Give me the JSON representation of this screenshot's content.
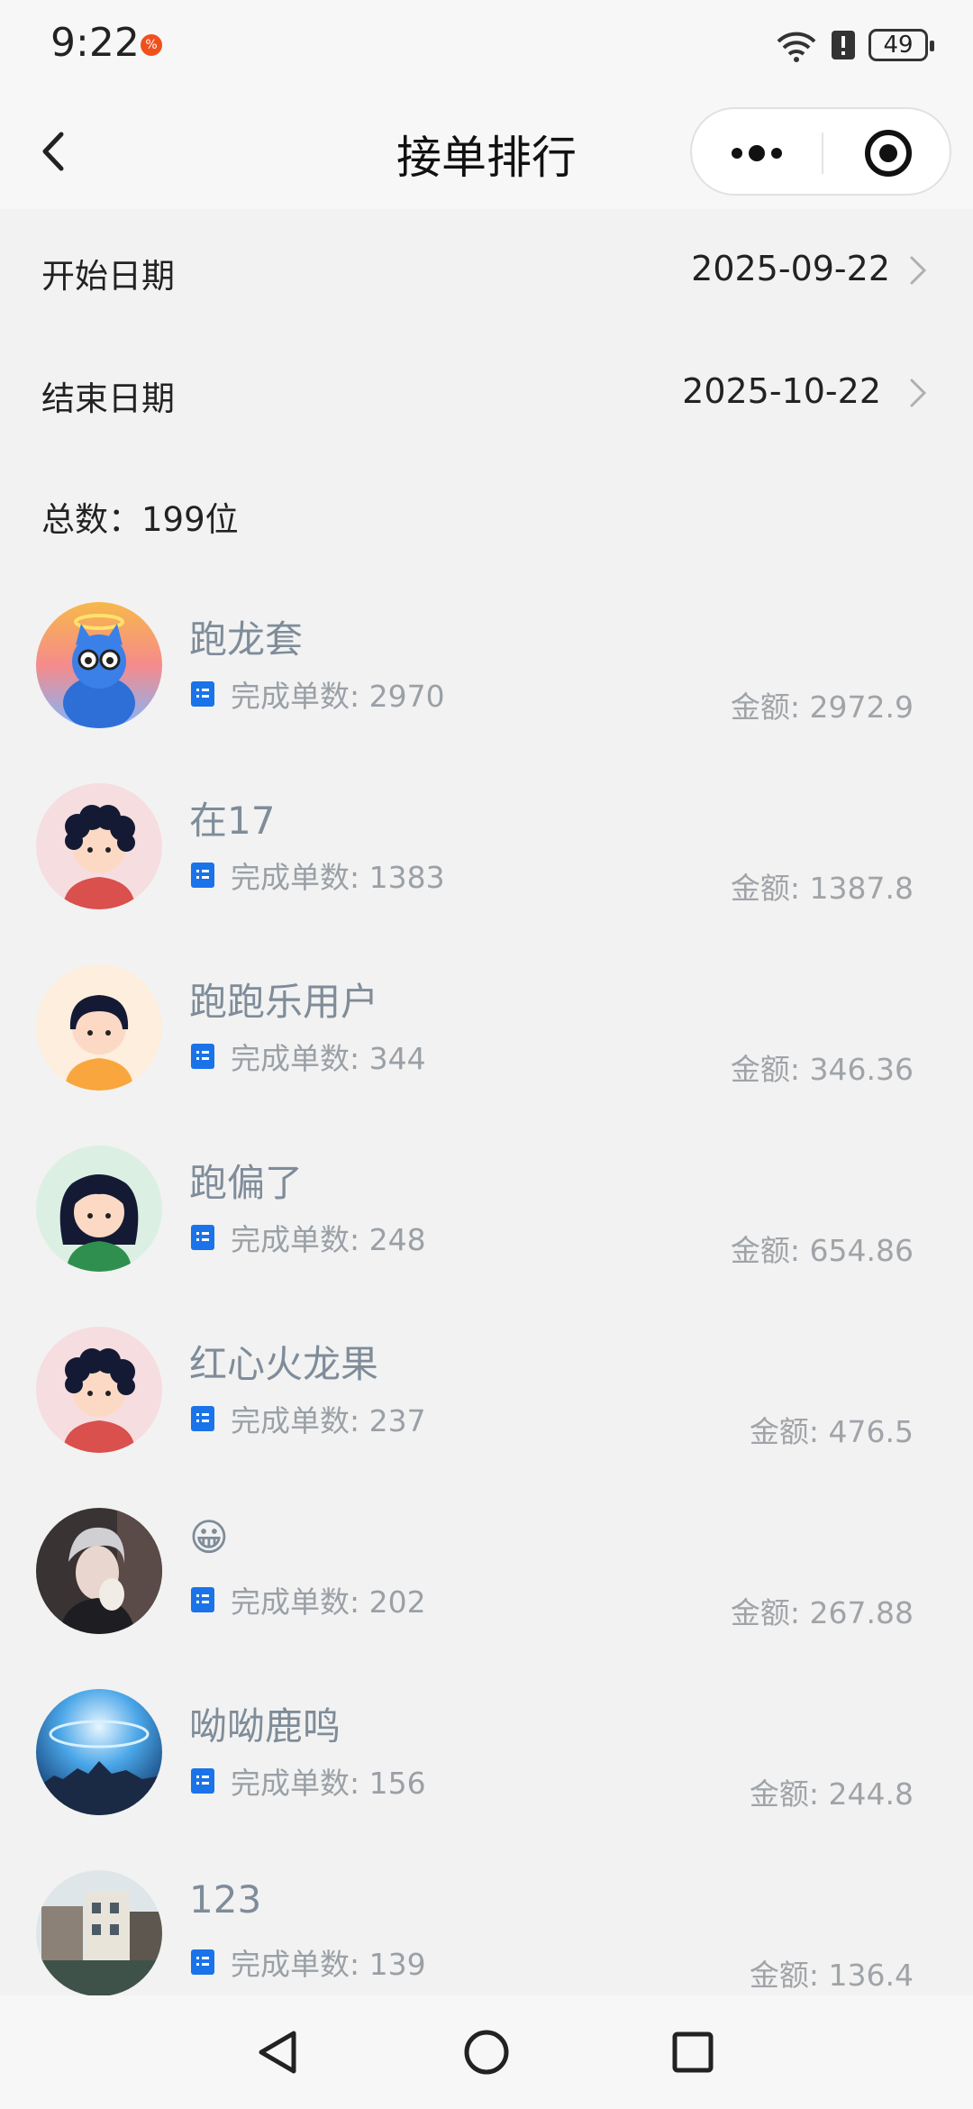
{
  "status_bar": {
    "time": "9:22",
    "notification_badge": "%",
    "battery": "49",
    "icons": [
      "wifi-icon",
      "alert-icon",
      "battery-icon"
    ]
  },
  "nav": {
    "title": "接单排行",
    "icons": [
      "back-icon",
      "more-dots-icon",
      "close-target-icon"
    ]
  },
  "filters": {
    "start": {
      "label": "开始日期",
      "value": "2025-09-22"
    },
    "end": {
      "label": "结束日期",
      "value": "2025-10-22"
    }
  },
  "total": "总数：199位",
  "colors": {
    "accent_icon": "#1a73e8",
    "name_text": "#7f8c99",
    "page_bg": "#f2f2f2"
  },
  "ranking": [
    {
      "name": "跑龙套",
      "count": "完成单数: 2970",
      "amount": "金额: 2972.9",
      "avatar": "blue-cat-avatar"
    },
    {
      "name": "在17",
      "count": "完成单数: 1383",
      "amount": "金额: 1387.8",
      "avatar": "curly-hair-avatar"
    },
    {
      "name": "跑跑乐用户",
      "count": "完成单数: 344",
      "amount": "金额: 346.36",
      "avatar": "bob-hair-avatar"
    },
    {
      "name": "跑偏了",
      "count": "完成单数: 248",
      "amount": "金额: 654.86",
      "avatar": "long-hair-avatar"
    },
    {
      "name": "红心火龙果",
      "count": "完成单数: 237",
      "amount": "金额: 476.5",
      "avatar": "curly-hair-avatar"
    },
    {
      "name": "😀",
      "count": "完成单数: 202",
      "amount": "金额: 267.88",
      "avatar": "photo-person-avatar"
    },
    {
      "name": "呦呦鹿鸣",
      "count": "完成单数: 156",
      "amount": "金额: 244.8",
      "avatar": "blue-sky-avatar"
    },
    {
      "name": "123",
      "count": "完成单数: 139",
      "amount": "金额: 136.4",
      "avatar": "town-photo-avatar"
    }
  ]
}
